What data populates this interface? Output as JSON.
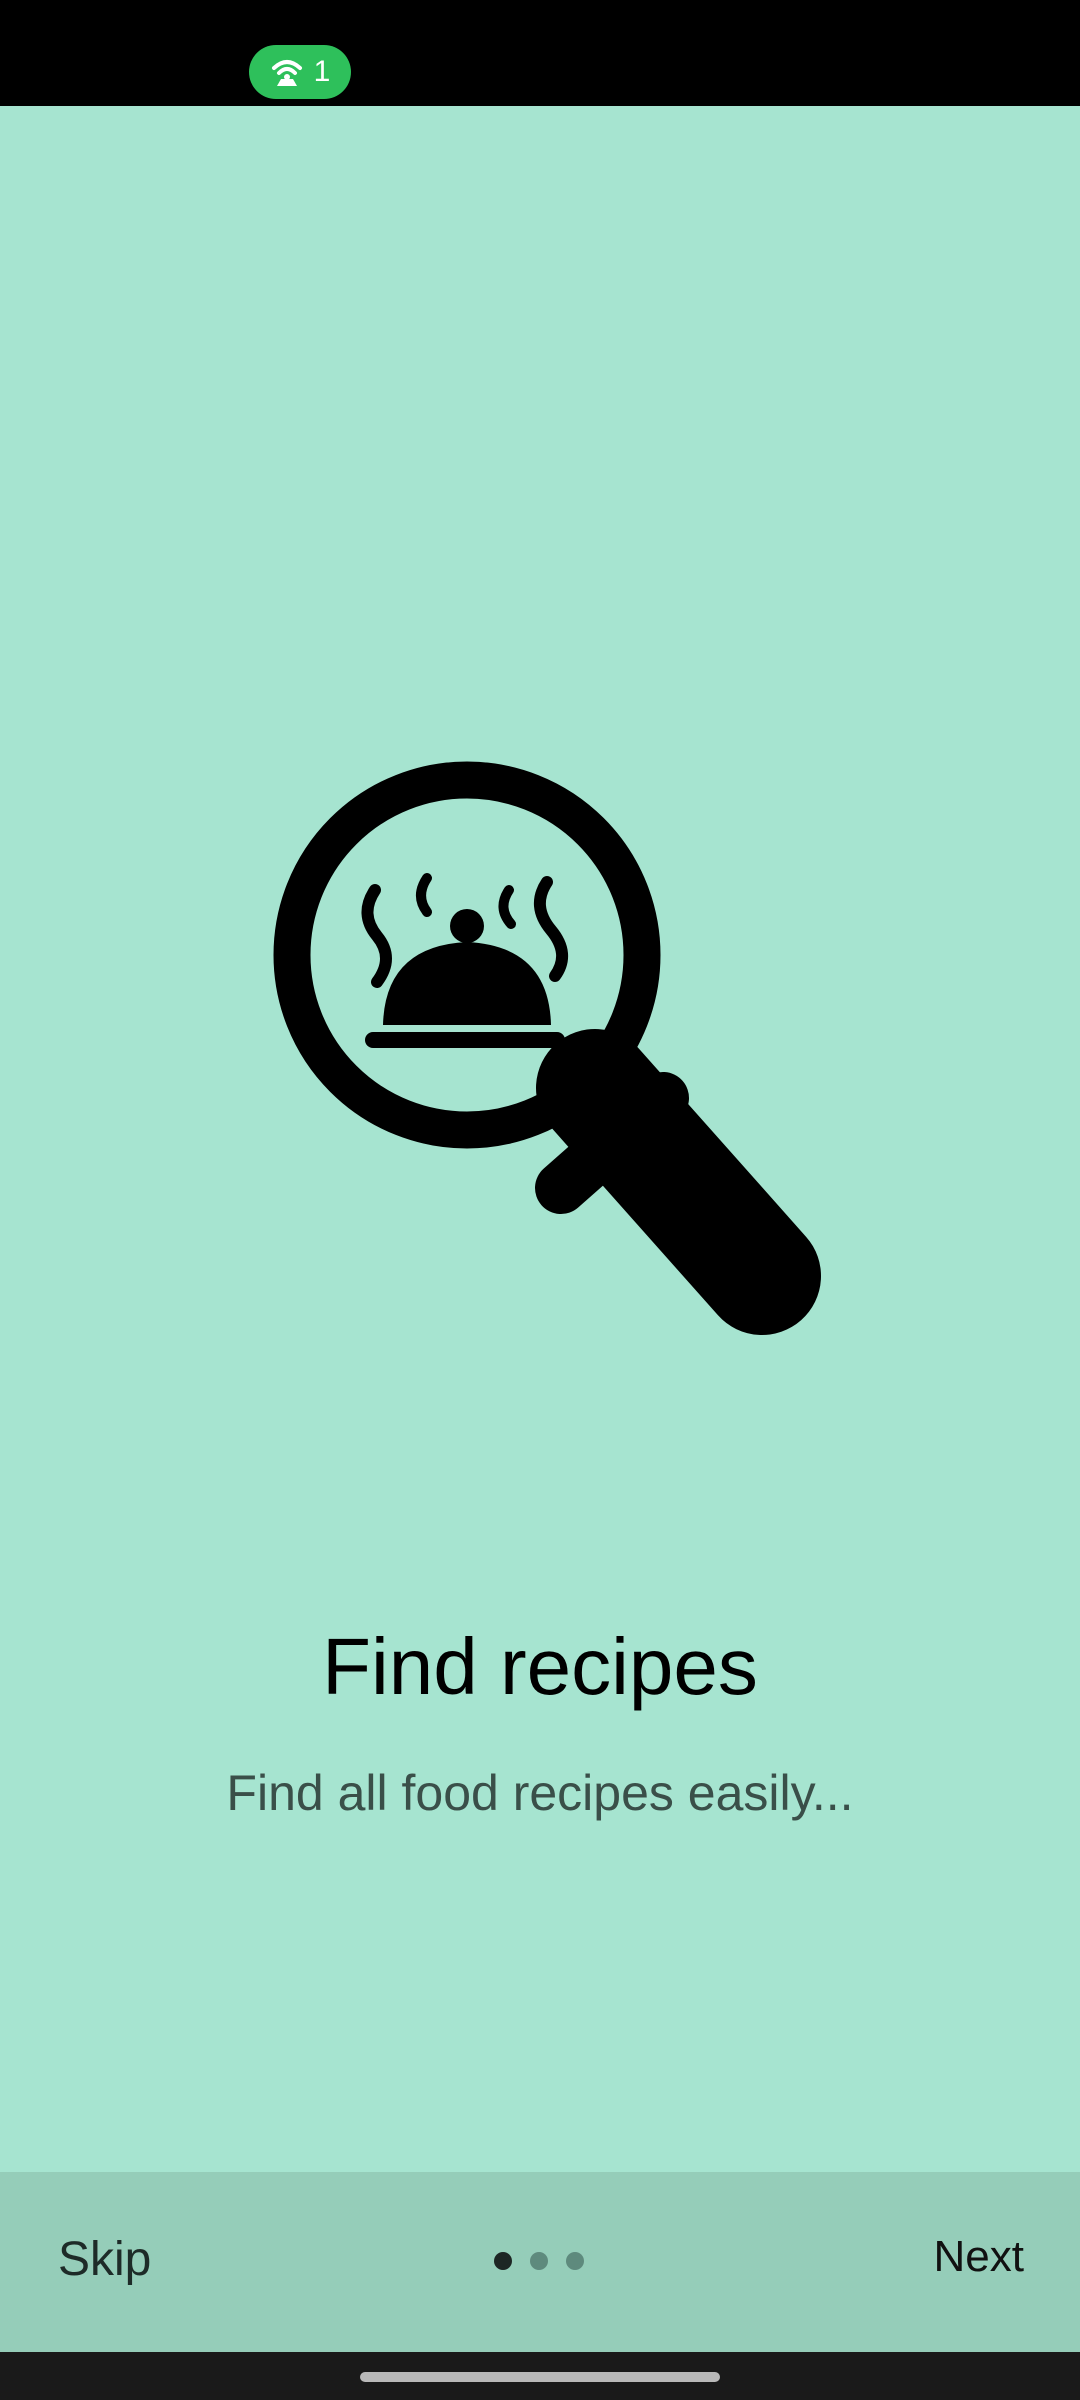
{
  "status_bar": {
    "hotspot_count": "1",
    "hotspot_icon": "hotspot-icon",
    "pill_color": "#2ec05b"
  },
  "onboarding": {
    "illustration_icon": "search-recipe-icon",
    "title": "Find recipes",
    "subtitle": "Find all food recipes easily...",
    "background_color": "#a6e4d0"
  },
  "footer": {
    "skip_label": "Skip",
    "next_label": "Next",
    "page_indicator": {
      "total": 3,
      "active_index": 0
    },
    "background_color": "#95cdb9"
  }
}
